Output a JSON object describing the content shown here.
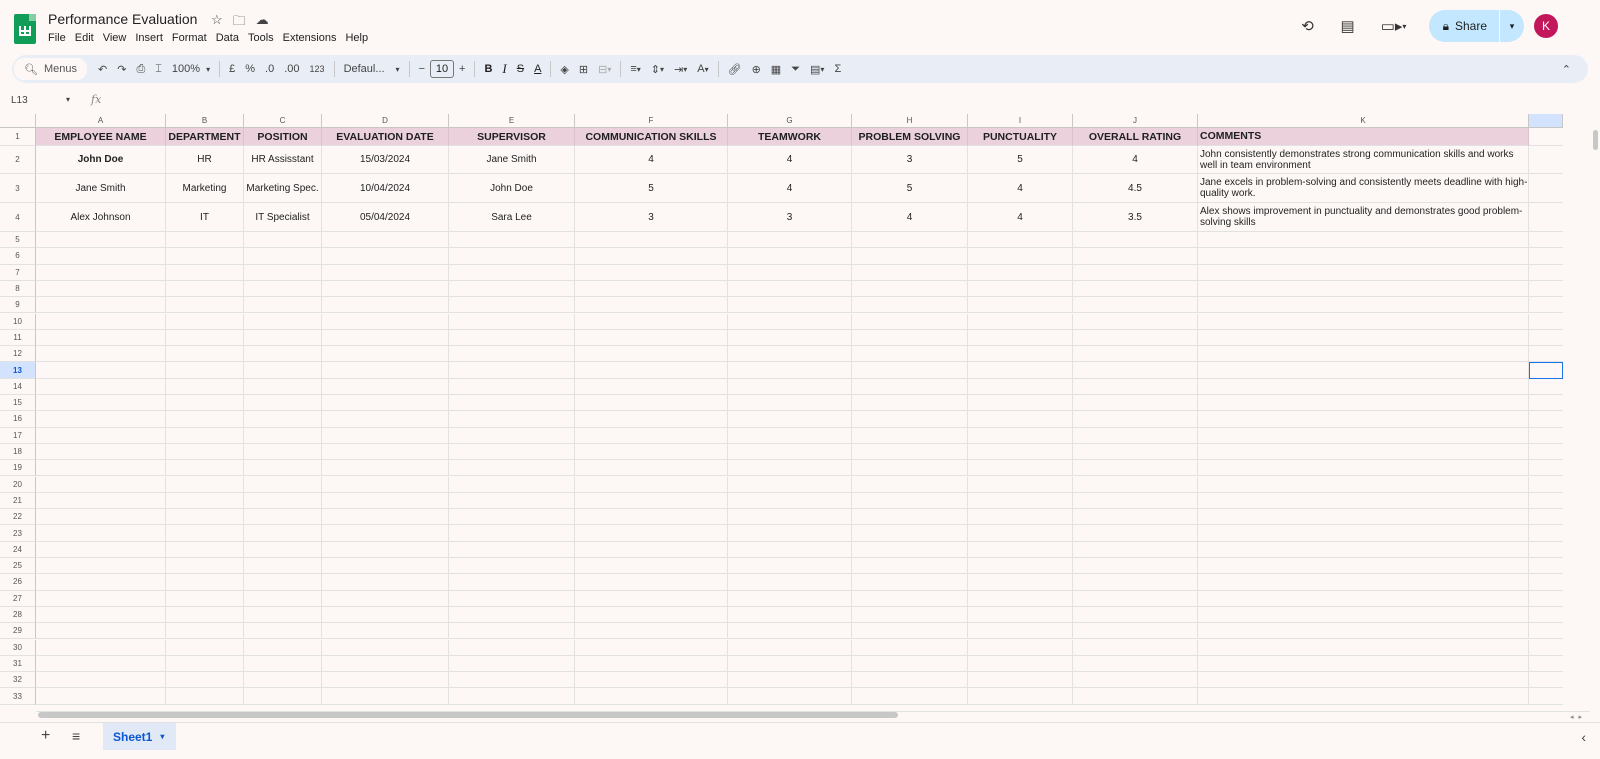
{
  "app": {
    "title": "Performance Evaluation",
    "menu": [
      "File",
      "Edit",
      "View",
      "Insert",
      "Format",
      "Data",
      "Tools",
      "Extensions",
      "Help"
    ],
    "share_label": "Share",
    "avatar_letter": "K",
    "accent": "#0b57d0",
    "header_fill": "#ead1dc"
  },
  "toolbar": {
    "search_label": "Menus",
    "zoom": "100%",
    "currency": "£",
    "percent": "%",
    "dec_decrease": ".0",
    "dec_increase": ".00",
    "number_format": "123",
    "font": "Defaul...",
    "font_size": "10",
    "bold": "B",
    "italic": "I",
    "strike": "S",
    "text_color": "A",
    "sum": "Σ"
  },
  "formula_bar": {
    "name_box": "L13",
    "fx": "fx"
  },
  "columns": [
    "A",
    "B",
    "C",
    "D",
    "E",
    "F",
    "G",
    "H",
    "I",
    "J",
    "K"
  ],
  "headers": [
    "EMPLOYEE NAME",
    "DEPARTMENT",
    "POSITION",
    "EVALUATION DATE",
    "SUPERVISOR",
    "COMMUNICATION SKILLS",
    "TEAMWORK",
    "PROBLEM SOLVING",
    "PUNCTUALITY",
    "OVERALL RATING",
    "COMMENTS"
  ],
  "rows": [
    [
      "John Doe",
      "HR",
      "HR Assisstant",
      "15/03/2024",
      "Jane Smith",
      "4",
      "4",
      "3",
      "5",
      "4",
      "John consistently demonstrates strong communication skills and works well in team environment"
    ],
    [
      "Jane Smith",
      "Marketing",
      "Marketing Spec.",
      "10/04/2024",
      "John Doe",
      "5",
      "4",
      "5",
      "4",
      "4.5",
      "Jane excels in problem-solving and consistently meets deadline with high-quality work."
    ],
    [
      "Alex Johnson",
      "IT",
      "IT Specialist",
      "05/04/2024",
      "Sara Lee",
      "3",
      "3",
      "4",
      "4",
      "3.5",
      "Alex shows improvement in punctuality and demonstrates good problem-solving skills"
    ]
  ],
  "row_numbers": [
    "1",
    "2",
    "3",
    "4",
    "5",
    "6",
    "7",
    "8",
    "9",
    "10",
    "11",
    "12",
    "13",
    "14",
    "15",
    "16",
    "17",
    "18",
    "19",
    "20",
    "21",
    "22",
    "23",
    "24",
    "25",
    "26",
    "27",
    "28",
    "29",
    "30",
    "31",
    "32",
    "33"
  ],
  "sheet_tab": "Sheet1",
  "selected_row": "13"
}
